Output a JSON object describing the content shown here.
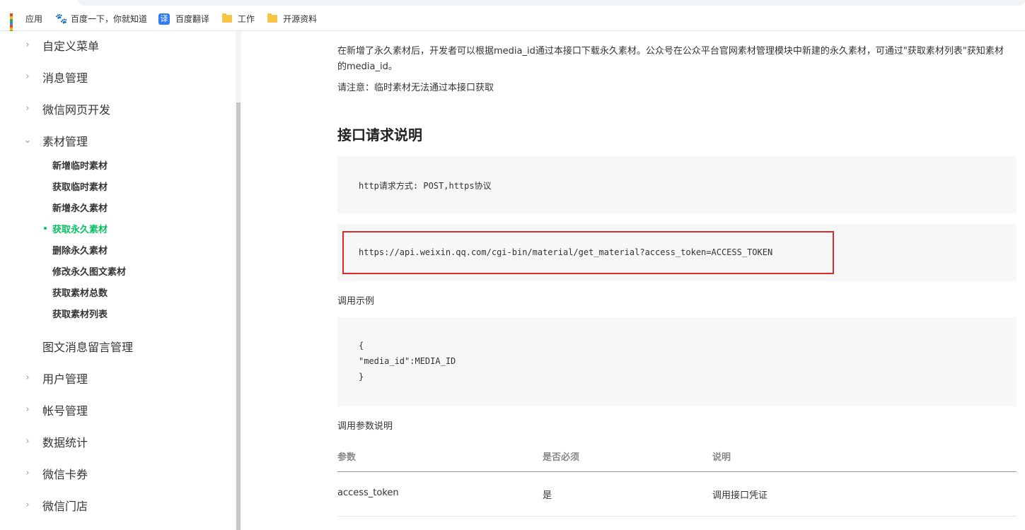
{
  "bookmarks": [
    {
      "label": "应用",
      "icon": "apps-grid-icon"
    },
    {
      "label": "百度一下，你就知道",
      "icon": "baidu-paw-icon"
    },
    {
      "label": "百度翻译",
      "icon": "baidu-translate-icon",
      "icon_text": "译"
    },
    {
      "label": "工作",
      "icon": "folder-icon"
    },
    {
      "label": "开源资料",
      "icon": "folder-icon"
    }
  ],
  "sidebar": {
    "items": [
      {
        "label": "自定义菜单",
        "chevron": "›"
      },
      {
        "label": "消息管理",
        "chevron": "›"
      },
      {
        "label": "微信网页开发",
        "chevron": "›"
      },
      {
        "label": "素材管理",
        "chevron": "⌄"
      }
    ],
    "sub_items": [
      {
        "label": "新增临时素材",
        "active": false
      },
      {
        "label": "获取临时素材",
        "active": false
      },
      {
        "label": "新增永久素材",
        "active": false
      },
      {
        "label": "获取永久素材",
        "active": true
      },
      {
        "label": "删除永久素材",
        "active": false
      },
      {
        "label": "修改永久图文素材",
        "active": false
      },
      {
        "label": "获取素材总数",
        "active": false
      },
      {
        "label": "获取素材列表",
        "active": false
      }
    ],
    "items_after": [
      {
        "label": "图文消息留言管理",
        "chevron": ""
      },
      {
        "label": "用户管理",
        "chevron": "›"
      },
      {
        "label": "帐号管理",
        "chevron": "›"
      },
      {
        "label": "数据统计",
        "chevron": "›"
      },
      {
        "label": "微信卡券",
        "chevron": "›"
      },
      {
        "label": "微信门店",
        "chevron": "›"
      }
    ]
  },
  "content": {
    "intro": "在新增了永久素材后，开发者可以根据media_id通过本接口下载永久素材。公众号在公众平台官网素材管理模块中新建的永久素材，可通过\"获取素材列表\"获知素材的media_id。",
    "note": "请注意：临时素材无法通过本接口获取",
    "heading": "接口请求说明",
    "request_method": "http请求方式: POST,https协议",
    "request_url": "https://api.weixin.qq.com/cgi-bin/material/get_material?access_token=ACCESS_TOKEN",
    "example_label": "调用示例",
    "example_lines": [
      "{",
      "\"media_id\":MEDIA_ID",
      "}"
    ],
    "params_label": "调用参数说明",
    "table": {
      "headers": [
        "参数",
        "是否必须",
        "说明"
      ],
      "rows": [
        [
          "access_token",
          "是",
          "调用接口凭证"
        ]
      ]
    }
  },
  "colors": {
    "accent": "#07c160",
    "highlight_box": "#e0282e",
    "code_bg": "#f7f7f7"
  }
}
